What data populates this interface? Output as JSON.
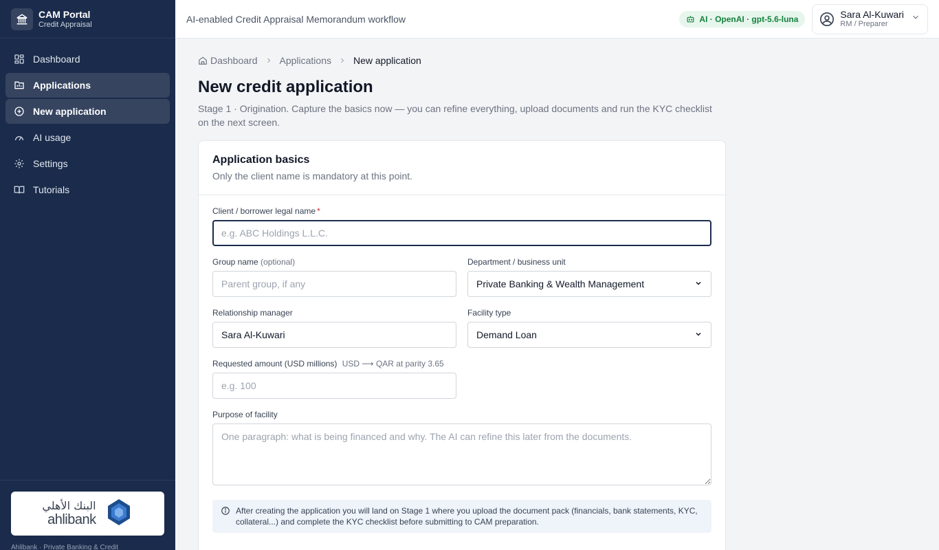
{
  "sidebar": {
    "brand": {
      "title": "CAM Portal",
      "subtitle": "Credit Appraisal"
    },
    "items": [
      {
        "label": "Dashboard",
        "icon": "dashboard-icon"
      },
      {
        "label": "Applications",
        "icon": "folder-chart-icon"
      },
      {
        "label": "New application",
        "icon": "plus-circle-icon"
      },
      {
        "label": "AI usage",
        "icon": "gauge-icon"
      },
      {
        "label": "Settings",
        "icon": "gear-icon"
      },
      {
        "label": "Tutorials",
        "icon": "book-icon"
      }
    ],
    "bank": {
      "name_ar": "البنك الأهلي",
      "name_en": "ahlibank"
    },
    "footer_text": "Ahlibank · Private Banking & Credit"
  },
  "topbar": {
    "title": "AI-enabled Credit Appraisal Memorandum workflow",
    "ai_badge": "AI · OpenAI · gpt-5.6-luna",
    "user": {
      "name": "Sara Al-Kuwari",
      "role": "RM / Preparer"
    }
  },
  "breadcrumb": {
    "home": "Dashboard",
    "applications": "Applications",
    "current": "New application"
  },
  "page": {
    "title": "New credit application",
    "description": "Stage 1 · Origination. Capture the basics now — you can refine everything, upload documents and run the KYC checklist on the next screen."
  },
  "form": {
    "title": "Application basics",
    "subtitle": "Only the client name is mandatory at this point.",
    "client_name": {
      "label": "Client / borrower legal name",
      "required_mark": "*",
      "placeholder": "e.g. ABC Holdings L.L.C.",
      "value": ""
    },
    "group_name": {
      "label": "Group name",
      "optional": "(optional)",
      "placeholder": "Parent group, if any",
      "value": ""
    },
    "department": {
      "label": "Department / business unit",
      "value": "Private Banking & Wealth Management"
    },
    "relationship_manager": {
      "label": "Relationship manager",
      "value": "Sara Al-Kuwari"
    },
    "facility_type": {
      "label": "Facility type",
      "value": "Demand Loan"
    },
    "requested_amount": {
      "label": "Requested amount (USD millions)",
      "hint": "USD ⟶ QAR at parity 3.65",
      "placeholder": "e.g. 100",
      "value": ""
    },
    "purpose": {
      "label": "Purpose of facility",
      "placeholder": "One paragraph: what is being financed and why. The AI can refine this later from the documents.",
      "value": ""
    },
    "info": "After creating the application you will land on Stage 1 where you upload the document pack (financials, bank statements, KYC, collateral...) and complete the KYC checklist before submitting to CAM preparation."
  },
  "colors": {
    "sidebar_bg": "#1b2b4b",
    "accent": "#1b2b4b",
    "ai_badge_bg": "#e6f6ec",
    "ai_badge_text": "#15803d",
    "required": "#dc2626"
  }
}
